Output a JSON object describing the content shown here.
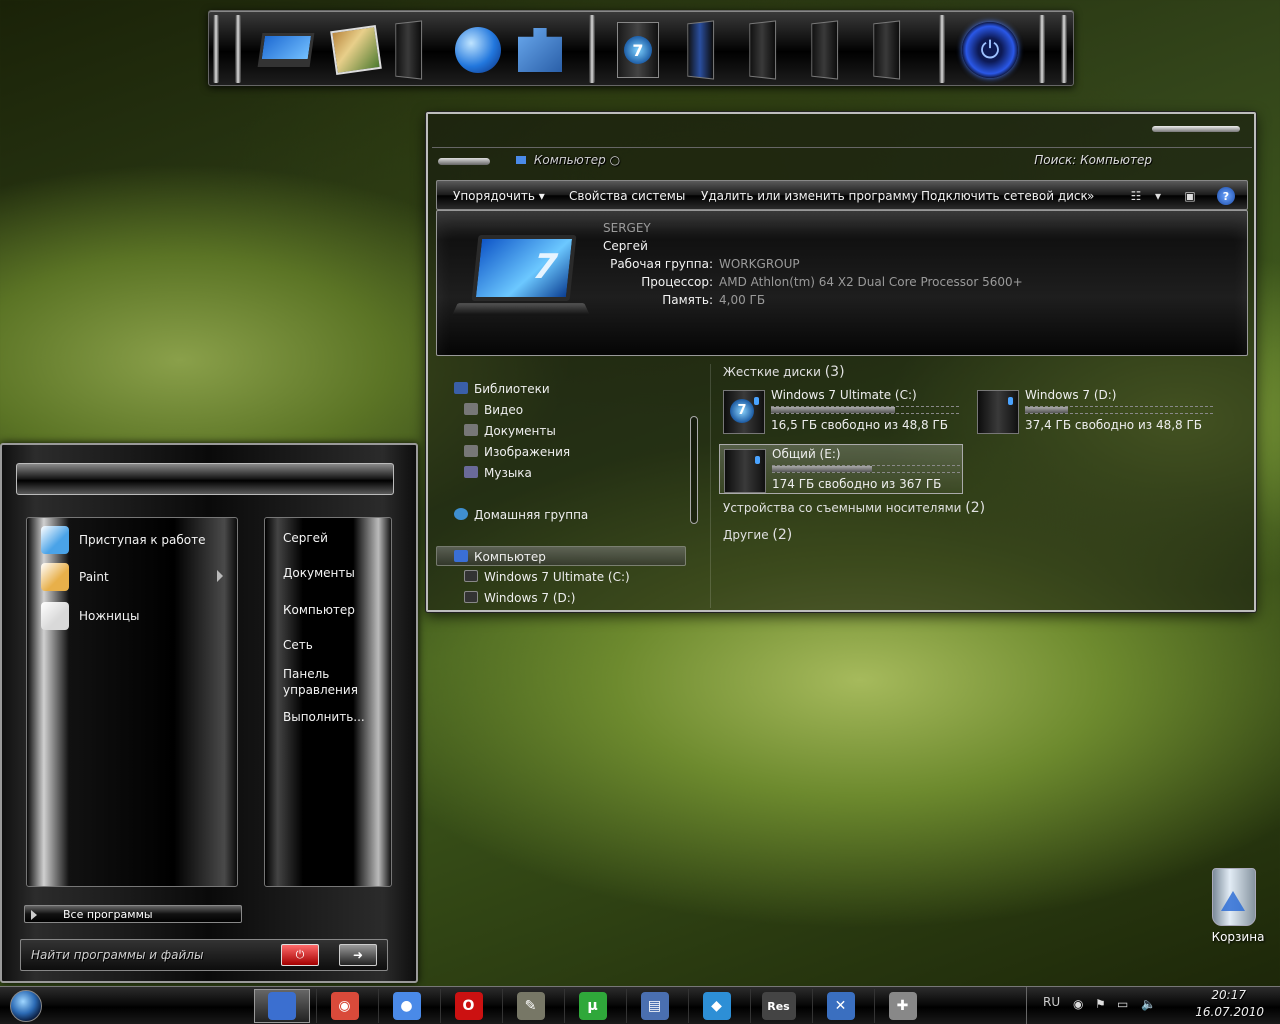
{
  "dock": {
    "icons": [
      "laptop-icon",
      "photos-icon",
      "blank-slab-icon",
      "network-globe-icon",
      "games-puzzle-icon",
      "windows7-drive-icon",
      "media-center-icon",
      "blank-slab-icon",
      "blank-slab-icon",
      "blank-slab-icon",
      "power-icon"
    ]
  },
  "explorer": {
    "address_path": "Компьютер",
    "search_placeholder": "Поиск: Компьютер",
    "toolbar": {
      "organize": "Упорядочить",
      "system_properties": "Свойства системы",
      "uninstall": "Удалить или изменить программу",
      "map_drive": "Подключить сетевой диск",
      "more": "»"
    },
    "details": {
      "computer_name": "SERGEY",
      "user": "Сергей",
      "workgroup_label": "Рабочая группа:",
      "workgroup_value": "WORKGROUP",
      "cpu_label": "Процессор:",
      "cpu_value": "AMD Athlon(tm) 64 X2 Dual Core Processor 5600+",
      "memory_label": "Память:",
      "memory_value": "4,00 ГБ"
    },
    "nav": {
      "libraries": "Библиотеки",
      "video": "Видео",
      "documents": "Документы",
      "images": "Изображения",
      "music": "Музыка",
      "homegroup": "Домашняя группа",
      "computer": "Компьютер",
      "drive_c": "Windows 7 Ultimate (C:)",
      "drive_d": "Windows 7  (D:)"
    },
    "groups": {
      "hard_disks": "Жесткие диски",
      "hard_disks_count": "(3)",
      "removable": "Устройства со съемными носителями",
      "removable_count": "(2)",
      "other": "Другие",
      "other_count": "(2)"
    },
    "drives": [
      {
        "name": "Windows 7 Ultimate (C:)",
        "free": "16,5 ГБ свободно из 48,8 ГБ",
        "used_fraction": 0.66
      },
      {
        "name": "Windows 7  (D:)",
        "free": "37,4 ГБ свободно из 48,8 ГБ",
        "used_fraction": 0.23
      },
      {
        "name": "Общий (E:)",
        "free": "174 ГБ свободно из 367 ГБ",
        "used_fraction": 0.53
      }
    ]
  },
  "start_menu": {
    "programs": [
      {
        "label": "Приступая к работе",
        "color": "#4aa3e8"
      },
      {
        "label": "Paint",
        "color": "#e8b04a"
      },
      {
        "label": "Ножницы",
        "color": "#d9d9d9"
      }
    ],
    "links": {
      "user": "Сергей",
      "documents": "Документы",
      "computer": "Компьютер",
      "network": "Сеть",
      "control_panel": "Панель управления",
      "run": "Выполнить..."
    },
    "all_programs": "Все программы",
    "search_placeholder": "Найти программы и файлы"
  },
  "desktop": {
    "recycle_bin": "Корзина"
  },
  "taskbar": {
    "apps": [
      {
        "icon": "explorer-icon",
        "color": "#3b6fd0",
        "glyph": "",
        "active": true
      },
      {
        "icon": "chrome-icon",
        "color": "#d94a3a",
        "glyph": "◉",
        "active": false
      },
      {
        "icon": "globe-icon",
        "color": "#4a8ae8",
        "glyph": "●",
        "active": false
      },
      {
        "icon": "opera-icon",
        "color": "#cc1111",
        "glyph": "O",
        "active": false
      },
      {
        "icon": "gimp-icon",
        "color": "#777766",
        "glyph": "✎",
        "active": false
      },
      {
        "icon": "utorrent-icon",
        "color": "#2fa83a",
        "glyph": "µ",
        "active": false
      },
      {
        "icon": "document-icon",
        "color": "#4a6fb0",
        "glyph": "▤",
        "active": false
      },
      {
        "icon": "package-icon",
        "color": "#2d8fd6",
        "glyph": "◆",
        "active": false
      },
      {
        "icon": "reshacker-icon",
        "color": "#444444",
        "glyph": "Res",
        "active": false
      },
      {
        "icon": "tools-icon",
        "color": "#3a6fc0",
        "glyph": "✕",
        "active": false
      },
      {
        "icon": "wrench-icon",
        "color": "#888888",
        "glyph": "✚",
        "active": false
      }
    ],
    "tray": {
      "lang": "RU",
      "time": "20:17",
      "date": "16.07.2010"
    }
  }
}
